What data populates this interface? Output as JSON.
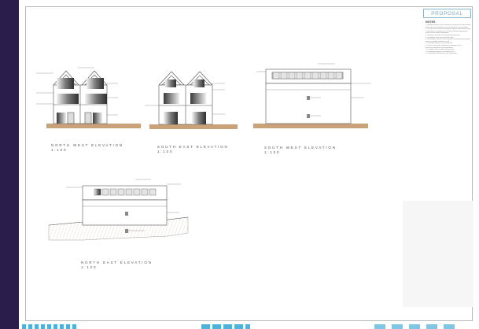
{
  "window": {
    "background": "#2b1d4b"
  },
  "sheet": {
    "title": "PROPOSAL",
    "notes_title": "NOTES",
    "notes": [
      "1. All dimensions to be checked on site prior to construction",
      "   works. Any discrepancies to be reported to the designer.",
      "2. Do not scale from this drawing. Figured dimensions only.",
      "3. All works to comply with current Building Regulations",
      "   and relevant British Standards.",
      "4. Materials to match existing where possible.",
      "5. Rooflights to be conservation type.",
      "6. All external finishes to be agreed with planning authority",
      "   prior to commencement on site.",
      "7. Drainage details to be confirmed.",
      "8. Refer to structural engineers drawings for all",
      "   structural elements and foundations.",
      "9. Windows to be double glazed units.",
      "10. Rainwater goods to be black uPVC.",
      "11. Boundary treatments to be confirmed."
    ],
    "elevations": [
      {
        "name": "NORTH WEST ELEVATION",
        "scale": "1:100"
      },
      {
        "name": "SOUTH EAST ELEVATION",
        "scale": "1:100"
      },
      {
        "name": "SOUTH WEST ELEVATION",
        "scale": "1:100"
      },
      {
        "name": "NORTH EAST ELEVATION",
        "scale": "1:100"
      }
    ]
  },
  "colors": {
    "accent": "#7aa6c6",
    "ground": "#c9a27a",
    "line": "#555555",
    "bottom_stripe": "#4fb3d9"
  }
}
